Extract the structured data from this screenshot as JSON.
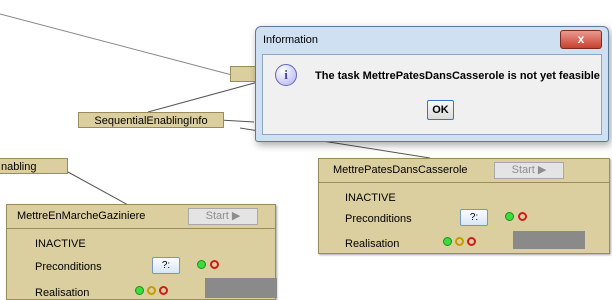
{
  "tree_nodes": {
    "top_partial": "",
    "sequential": "SequentialEnablingInfo",
    "enabling": "nabling"
  },
  "tasks": [
    {
      "title": "MettreEnMarcheGaziniere",
      "start_label": "Start ▶",
      "state": "INACTIVE",
      "preconditions_label": "Preconditions",
      "query_label": "?:",
      "realisation_label": "Realisation"
    },
    {
      "title": "MettrePatesDansCasserole",
      "start_label": "Start ▶",
      "state": "INACTIVE",
      "preconditions_label": "Preconditions",
      "query_label": "?:",
      "realisation_label": "Realisation"
    }
  ],
  "dialog": {
    "title": "Information",
    "close_label": "x",
    "icon": "info-icon",
    "message": "The task MettrePatesDansCasserole is not yet feasible",
    "ok_label": "OK"
  },
  "colors": {
    "node_fill": "#dccf9f",
    "node_border": "#9a8c5c",
    "green": "#3ddc3d",
    "red": "#d01b1b",
    "yellow": "#c49b00",
    "dialog_frame": "#cfe0f2"
  }
}
